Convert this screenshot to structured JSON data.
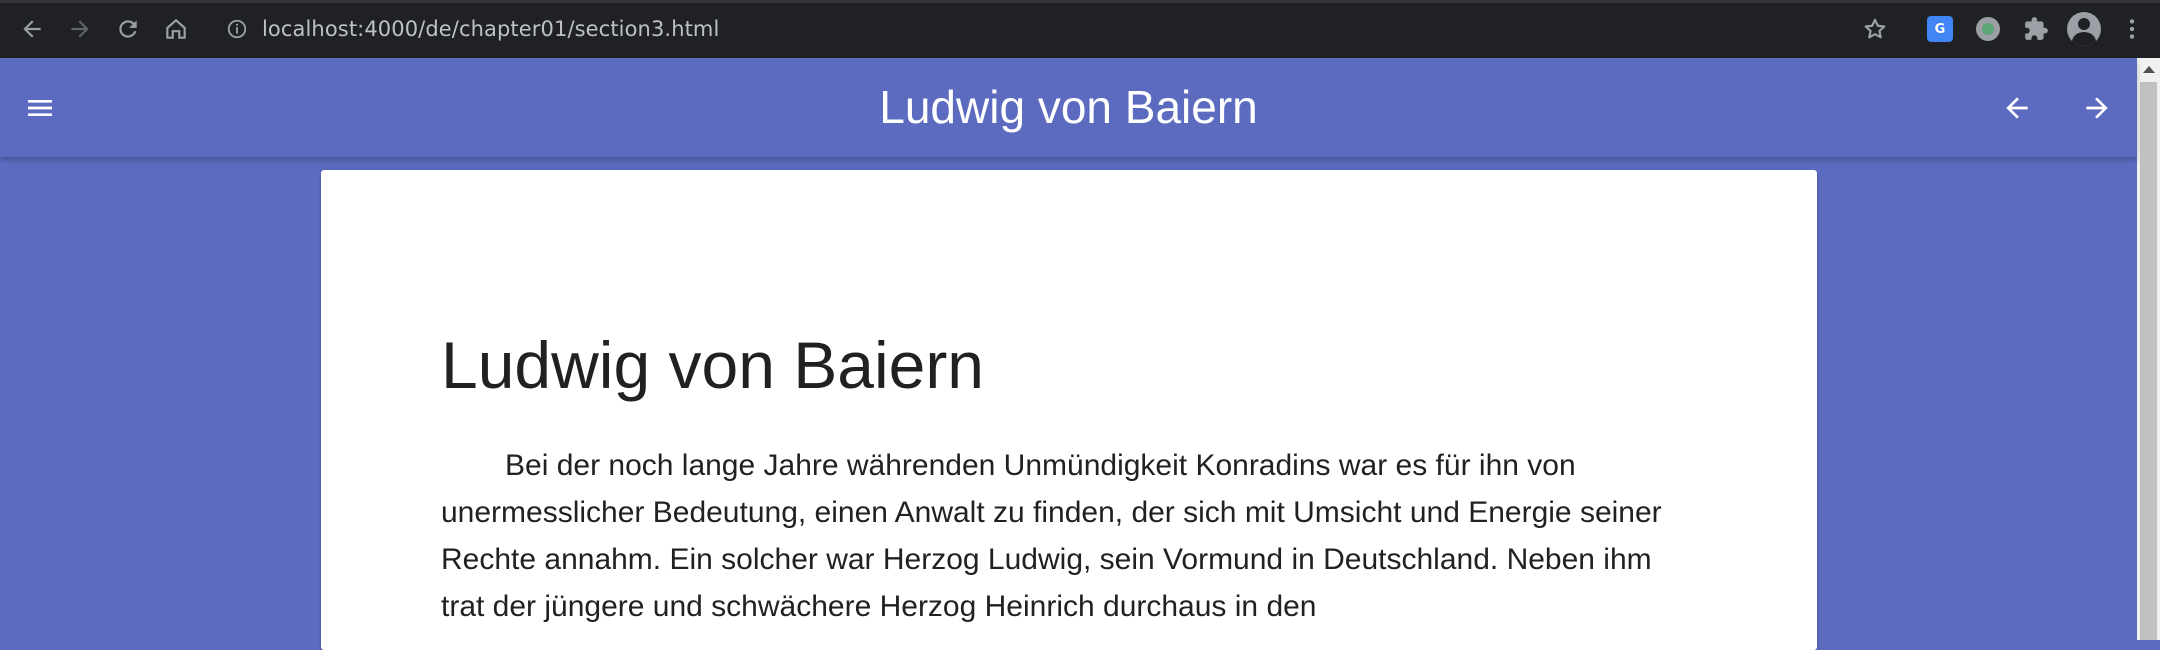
{
  "browser": {
    "url": "localhost:4000/de/chapter01/section3.html",
    "extensions": {
      "translate_label": "G"
    }
  },
  "toolbar": {
    "title": "Ludwig von Baiern",
    "menu_icon": "menu-icon",
    "prev_icon": "arrow-back-icon",
    "next_icon": "arrow-forward-icon",
    "background_color": "#5c6bc0"
  },
  "article": {
    "heading": "Ludwig von Baiern",
    "paragraph": "Bei der noch lange Jahre währenden Unmündigkeit Konradins war es für ihn von unermesslicher Bedeutung, einen Anwalt zu finden, der sich mit Umsicht und Energie seiner Rechte annahm. Ein solcher war Herzog Ludwig, sein Vormund in Deutschland. Neben ihm trat der jüngere und schwächere Herzog Heinrich durchaus in den"
  }
}
